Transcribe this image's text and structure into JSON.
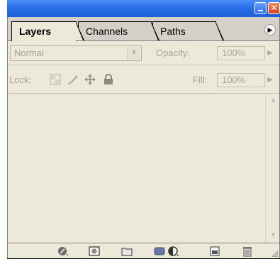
{
  "tabs": [
    {
      "label": "Layers",
      "active": true
    },
    {
      "label": "Channels",
      "active": false
    },
    {
      "label": "Paths",
      "active": false
    }
  ],
  "blend_mode": {
    "selected": "Normal"
  },
  "opacity": {
    "label": "Opacity:",
    "value": "100%"
  },
  "lock": {
    "label": "Lock:"
  },
  "fill": {
    "label": "Fill:",
    "value": "100%"
  },
  "icons": {
    "titlebar": [
      "minimize-icon",
      "close-icon"
    ],
    "panel_menu": "panel-menu-arrow-icon",
    "lock": [
      "lock-transparent-pixels-icon",
      "lock-image-pixels-icon",
      "lock-position-icon",
      "lock-all-icon"
    ],
    "bottom": [
      "link-layers-icon",
      "add-layer-mask-icon",
      "new-group-icon",
      "new-adjustment-layer-icon",
      "new-layer-icon",
      "delete-layer-icon"
    ]
  },
  "colors": {
    "titlebar": "#2a6ee8",
    "panel_bg": "#ece9d8",
    "tab_bg": "#d4d0c8",
    "disabled_text": "#a8a498"
  }
}
